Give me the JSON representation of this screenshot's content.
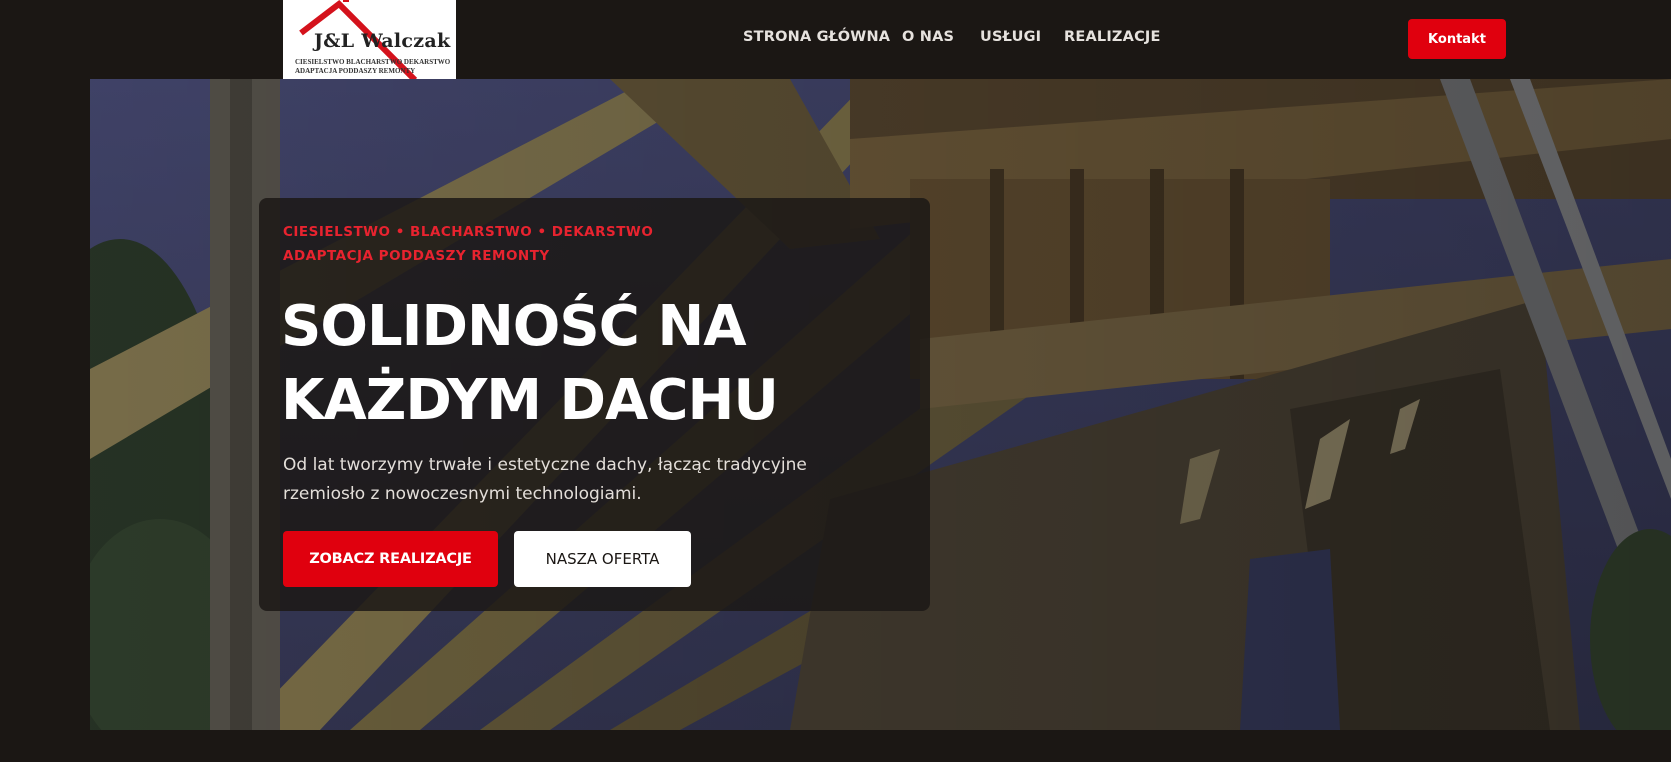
{
  "logo": {
    "name": "J&L Walczak",
    "tagline_line1": "CIESIELSTWO BLACHARSTWO DEKARSTWO",
    "tagline_line2": "ADAPTACJA PODDASZY REMONTY"
  },
  "nav": {
    "items": [
      {
        "label": "STRONA GŁÓWNA"
      },
      {
        "label": "O NAS"
      },
      {
        "label": "USŁUGI"
      },
      {
        "label": "REALIZACJE"
      }
    ],
    "contact_label": "Kontakt"
  },
  "hero": {
    "kicker_line1": "CIESIELSTWO • BLACHARSTWO • DEKARSTWO",
    "kicker_line2": "ADAPTACJA PODDASZY REMONTY",
    "headline_line1": "SOLIDNOŚĆ NA",
    "headline_line2": "KAŻDYM DACHU",
    "lead": "Od lat tworzymy trwałe i estetyczne dachy, łącząc tradycyjne rzemiosło z nowoczesnymi technologiami.",
    "primary_button": "ZOBACZ REALIZACJE",
    "secondary_button": "NASZA OFERTA"
  },
  "colors": {
    "background": "#1b1714",
    "accent": "#e0000e",
    "kicker": "#e8232f",
    "text": "#ffffff"
  },
  "icons": {
    "logo_roof": "roof-outline-icon"
  }
}
